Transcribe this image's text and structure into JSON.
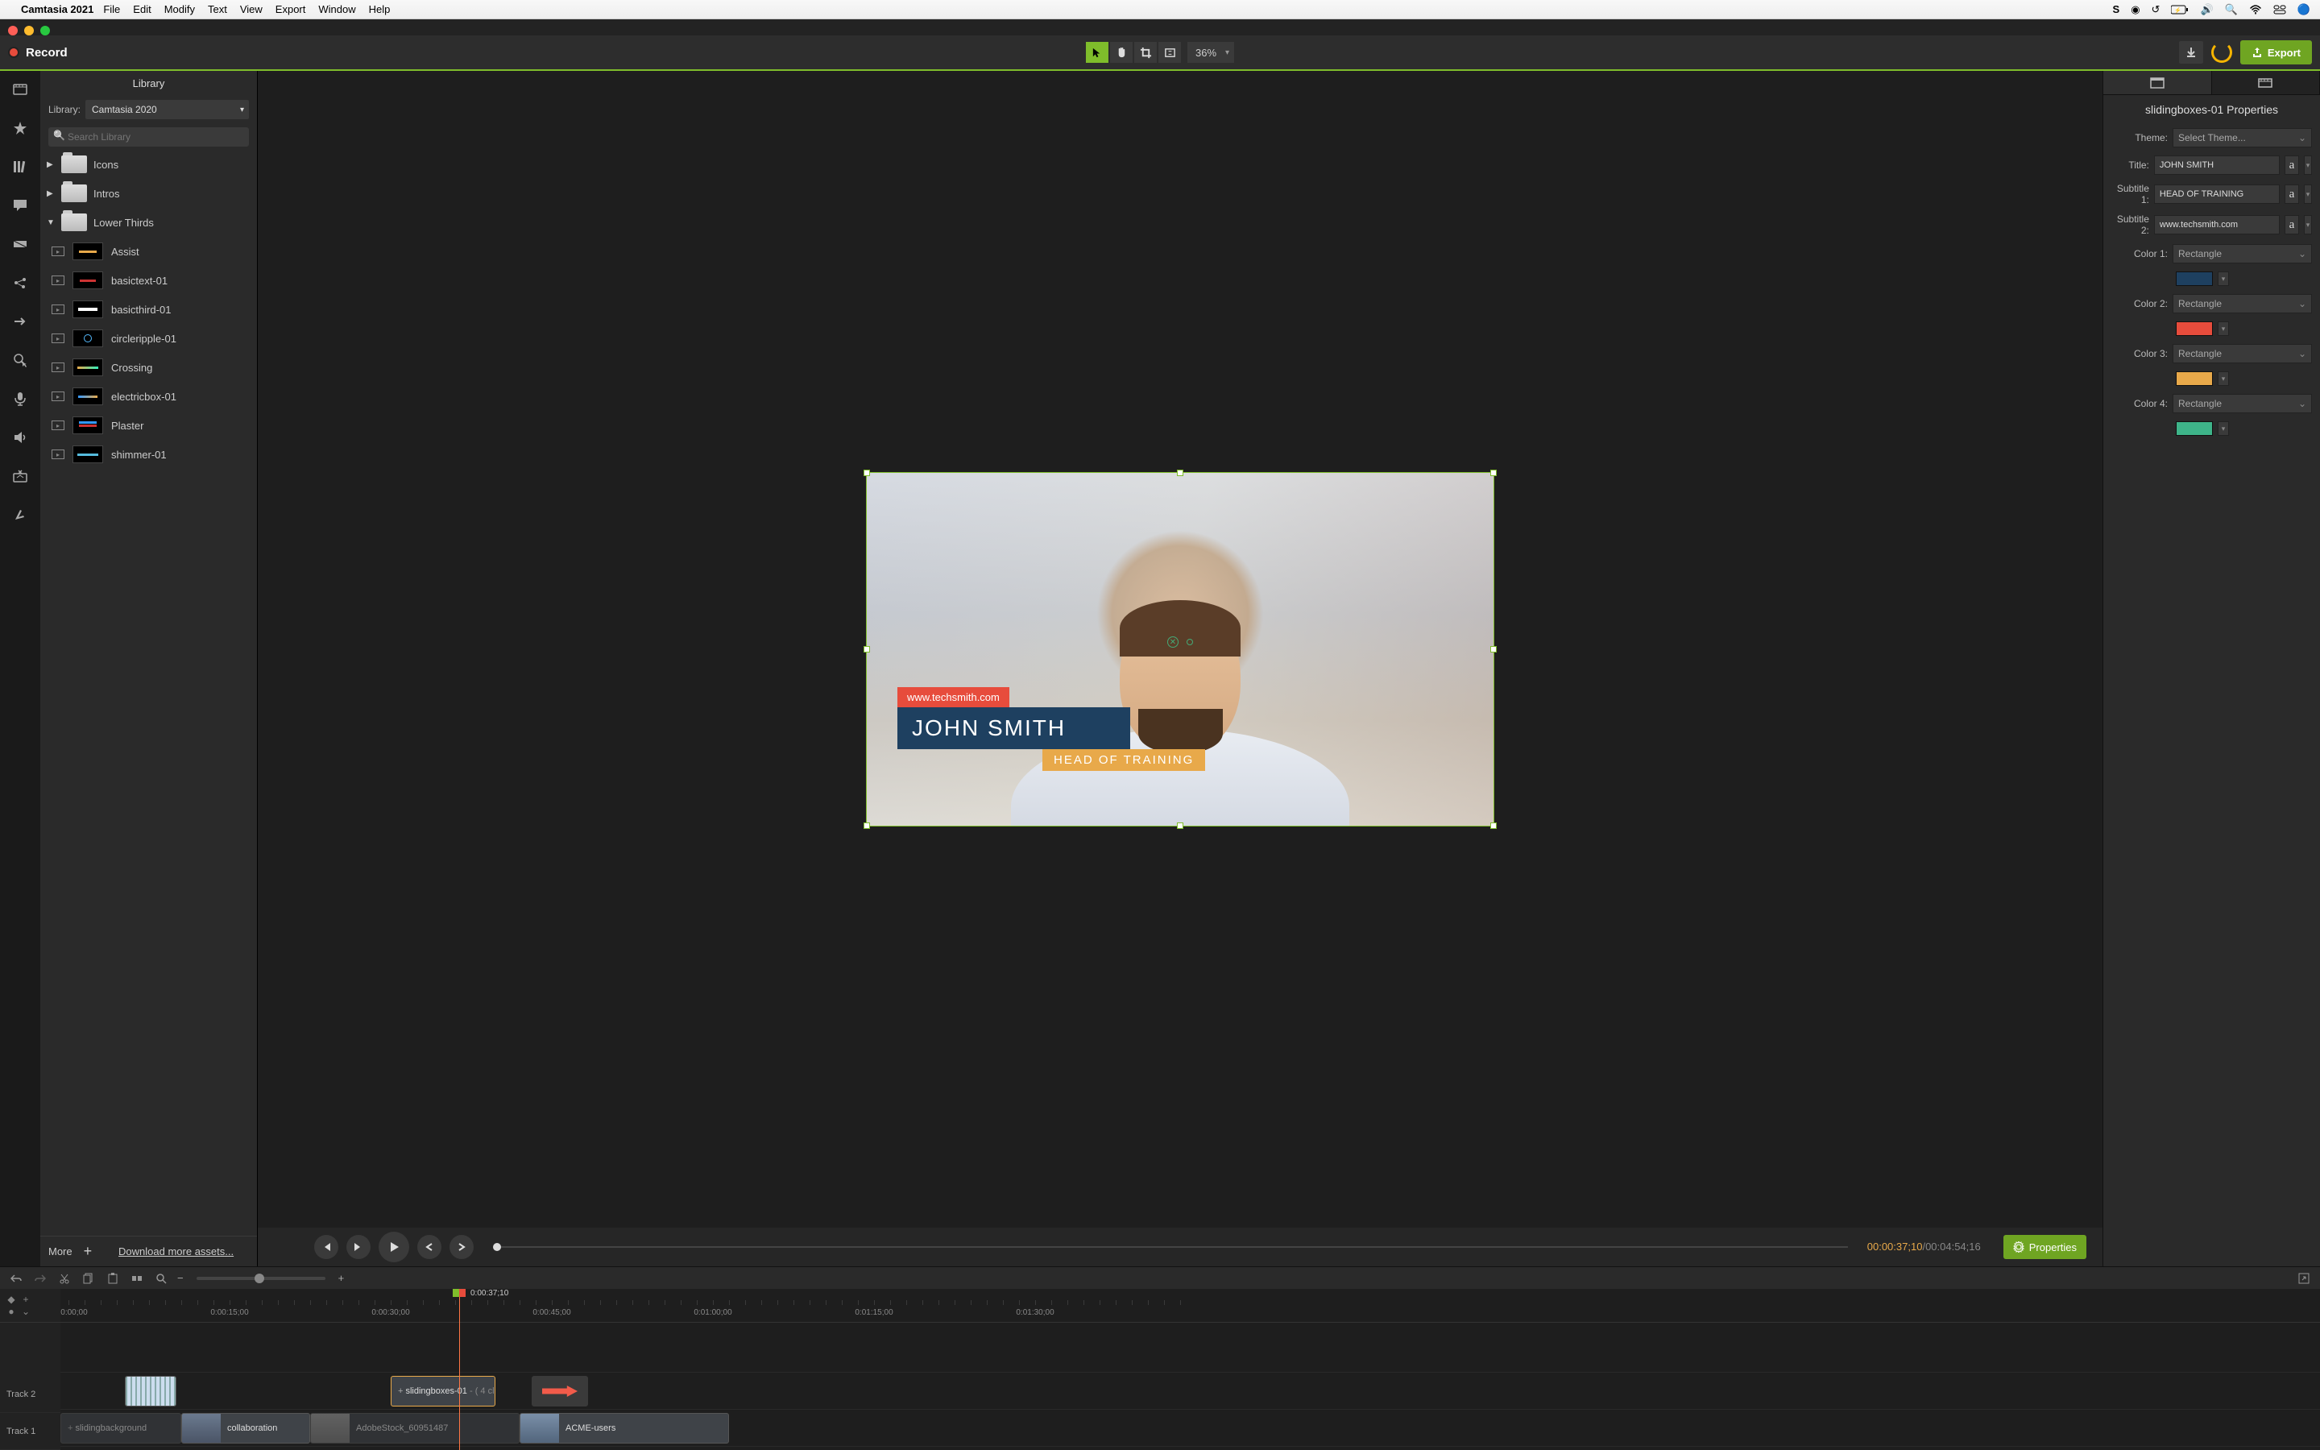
{
  "menubar": {
    "app": "Camtasia 2021",
    "items": [
      "File",
      "Edit",
      "Modify",
      "Text",
      "View",
      "Export",
      "Window",
      "Help"
    ]
  },
  "toolbar": {
    "record": "Record",
    "zoom": "36%",
    "export": "Export"
  },
  "library": {
    "title": "Library",
    "label": "Library:",
    "selected": "Camtasia 2020",
    "search_placeholder": "Search Library",
    "folders": [
      {
        "name": "Icons",
        "open": false
      },
      {
        "name": "Intros",
        "open": false
      },
      {
        "name": "Lower Thirds",
        "open": true
      }
    ],
    "items": [
      "Assist",
      "basictext-01",
      "basicthird-01",
      "circleripple-01",
      "Crossing",
      "electricbox-01",
      "Plaster",
      "shimmer-01"
    ],
    "more": "More",
    "download": "Download more assets..."
  },
  "canvas": {
    "url": "www.techsmith.com",
    "name": "JOHN SMITH",
    "subtitle": "HEAD OF TRAINING"
  },
  "playback": {
    "current": "00:00:37;10",
    "duration": "00:04:54;16",
    "properties_btn": "Properties"
  },
  "properties": {
    "title": "slidingboxes-01 Properties",
    "theme_label": "Theme:",
    "theme_value": "Select Theme...",
    "title_label": "Title:",
    "title_value": "JOHN SMITH",
    "sub1_label": "Subtitle 1:",
    "sub1_value": "HEAD OF TRAINING",
    "sub2_label": "Subtitle 2:",
    "sub2_value": "www.techsmith.com",
    "color1_label": "Color 1:",
    "color1_shape": "Rectangle",
    "color1": "#1e4060",
    "color2_label": "Color 2:",
    "color2_shape": "Rectangle",
    "color2": "#e74c3c",
    "color3_label": "Color 3:",
    "color3_shape": "Rectangle",
    "color3": "#e8a94a",
    "color4_label": "Color 4:",
    "color4_shape": "Rectangle",
    "color4": "#3eb489",
    "a": "a"
  },
  "timeline": {
    "playhead_time": "0:00:37;10",
    "ruler": [
      "0:00:00;00",
      "0:00:15;00",
      "0:00:30;00",
      "0:00:45;00",
      "0:01:00;00",
      "0:01:15;00",
      "0:01:30;00"
    ],
    "tracks": [
      "Track 2",
      "Track 1"
    ],
    "clips": {
      "t2_a": "",
      "t2_b": "slidingboxes-01",
      "t2_b_suffix": " - ( 4 cl",
      "t1_a": "slidingbackground",
      "t1_b": "collaboration",
      "t1_c": "AdobeStock_60951487",
      "t1_d": "ACME-users"
    }
  }
}
